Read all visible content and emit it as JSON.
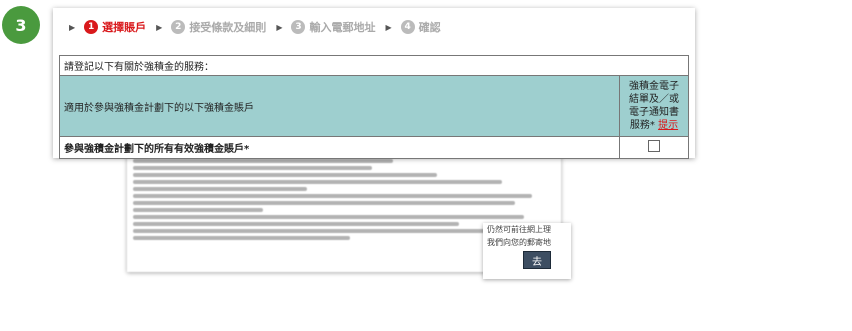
{
  "step_badge": "3",
  "breadcrumb": [
    {
      "num": "1",
      "label": "選擇賬戶",
      "active": true
    },
    {
      "num": "2",
      "label": "接受條款及細則",
      "active": false
    },
    {
      "num": "3",
      "label": "輸入電郵地址",
      "active": false
    },
    {
      "num": "4",
      "label": "確認",
      "active": false
    }
  ],
  "table": {
    "title": "請登記以下有關於強積金的服務：",
    "header_left": "適用於參與強積金計劃下的以下強積金賬戶",
    "header_right_lines": [
      "強積金電子",
      "結單及／或",
      "電子通知書",
      "服務*"
    ],
    "header_right_link": "提示",
    "row_label": "參與強積金計劃下的所有有效強積金賬戶*",
    "row_checked": false
  },
  "popup": {
    "text_line1": "仍然可前往網上理",
    "text_line2": "我們向您的郵寄地",
    "go_button": "去"
  },
  "colors": {
    "badge": "#4a9a3e",
    "active_step": "#d9191c",
    "table_header_bg": "#9ecfcf"
  }
}
